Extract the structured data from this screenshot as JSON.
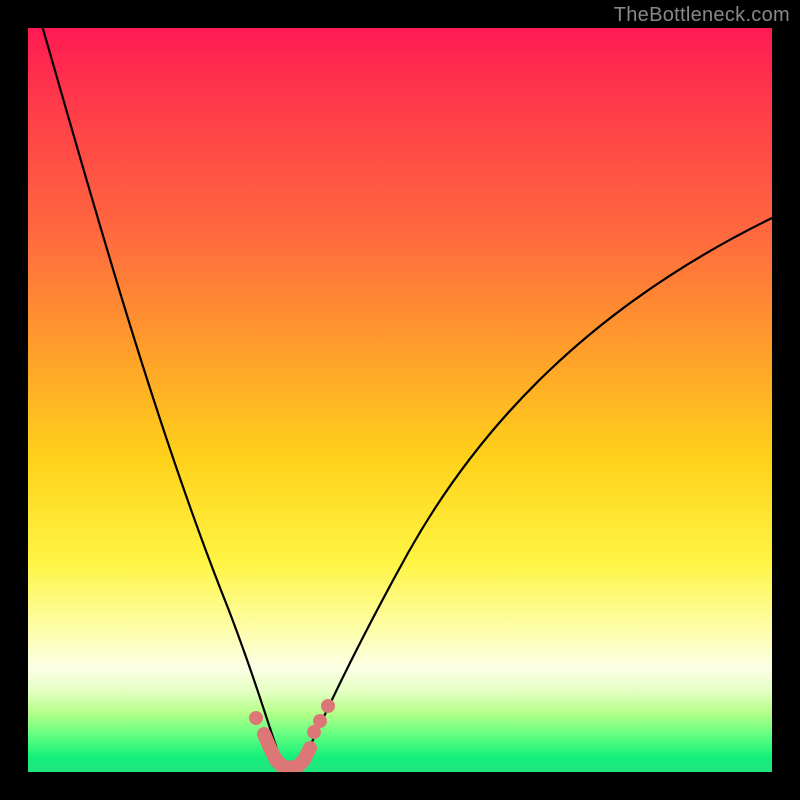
{
  "watermark": "TheBottleneck.com",
  "colors": {
    "background": "#000000",
    "watermark": "#888888",
    "curve": "#000000",
    "marker": "#dd7777",
    "gradient_top": "#ff1a52",
    "gradient_bottom": "#21e481"
  },
  "chart_data": {
    "type": "line",
    "title": "",
    "xlabel": "",
    "ylabel": "",
    "xlim": [
      0,
      100
    ],
    "ylim": [
      0,
      100
    ],
    "series": [
      {
        "name": "bottleneck-curve",
        "x": [
          0,
          5,
          10,
          15,
          20,
          25,
          28,
          30,
          32,
          33,
          33.5,
          34,
          35,
          36,
          37,
          38,
          40,
          45,
          55,
          65,
          75,
          85,
          95,
          100
        ],
        "y": [
          104,
          85,
          67,
          49,
          32,
          17,
          9,
          5,
          2,
          0.7,
          0.3,
          0.3,
          0.7,
          1.5,
          3,
          5,
          9,
          18,
          34,
          47,
          57,
          64,
          70,
          73
        ]
      }
    ],
    "markers": {
      "name": "highlight-dots",
      "x": [
        29.5,
        30.8,
        32.0,
        33.0,
        33.5,
        34.0,
        35.0,
        36.2,
        37.0,
        37.8,
        38.6
      ],
      "y": [
        5.5,
        3.3,
        1.5,
        0.7,
        0.3,
        0.3,
        0.7,
        2.0,
        3.5,
        5.0,
        6.5
      ]
    }
  }
}
